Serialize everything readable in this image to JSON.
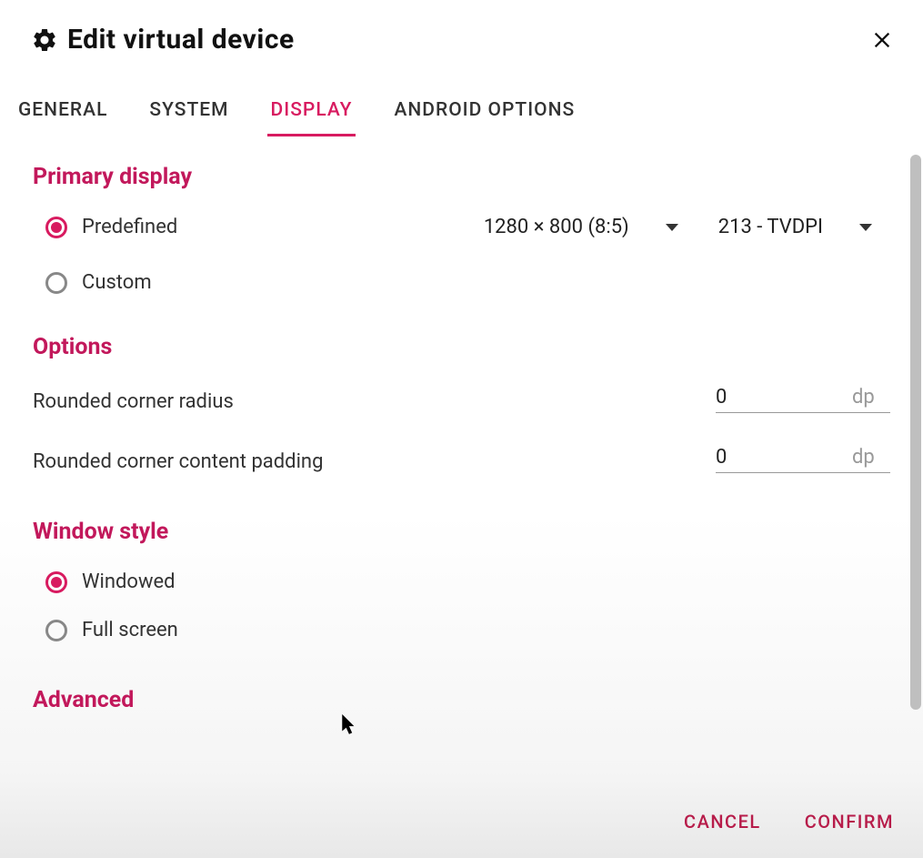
{
  "title": "Edit virtual device",
  "tabs": {
    "general": "GENERAL",
    "system": "SYSTEM",
    "display": "DISPLAY",
    "android_options": "ANDROID OPTIONS"
  },
  "primary_display": {
    "heading": "Primary display",
    "predefined_label": "Predefined",
    "custom_label": "Custom",
    "resolution_value": "1280 × 800 (8:5)",
    "dpi_value": "213 - TVDPI"
  },
  "options": {
    "heading": "Options",
    "radius_label": "Rounded corner radius",
    "radius_value": "0",
    "padding_label": "Rounded corner content padding",
    "padding_value": "0",
    "unit": "dp"
  },
  "window_style": {
    "heading": "Window style",
    "windowed_label": "Windowed",
    "fullscreen_label": "Full screen"
  },
  "advanced": {
    "heading": "Advanced"
  },
  "footer": {
    "cancel": "CANCEL",
    "confirm": "CONFIRM"
  },
  "colors": {
    "accent": "#d81b60"
  }
}
